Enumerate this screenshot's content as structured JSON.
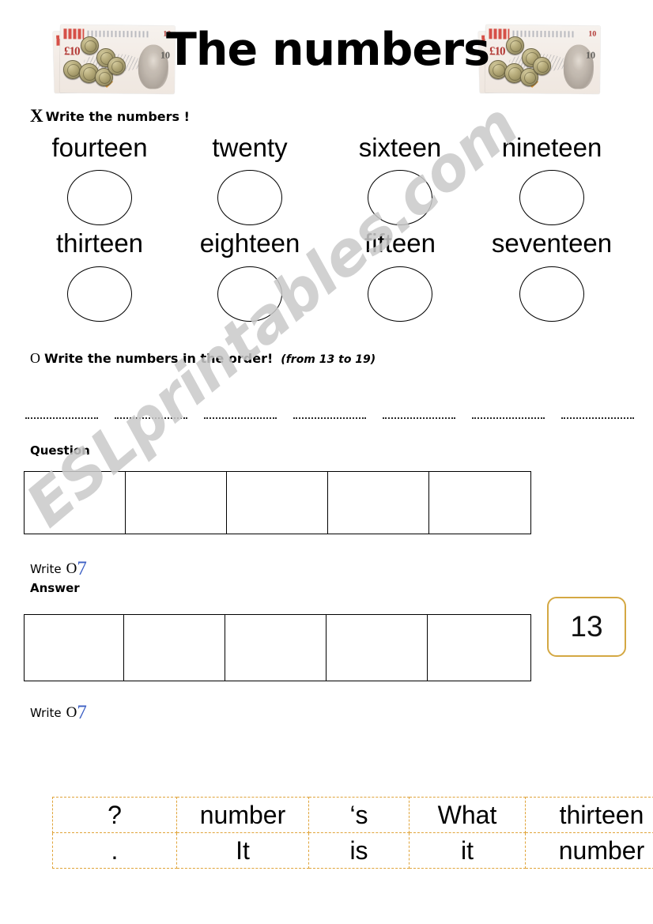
{
  "page": {
    "title": "The numbers",
    "watermark": "ESLprintables.com",
    "accent_orange": "#d4a843",
    "accent_blue": "#3c5fc4"
  },
  "decor": {
    "money_left": "banknote-coins-photo",
    "money_right": "banknote-coins-photo",
    "note_value": "£10"
  },
  "exercise1": {
    "bullet": "X",
    "instruction": "Write the numbers !",
    "row1": [
      "fourteen",
      "twenty",
      "sixteen",
      "nineteen"
    ],
    "row2": [
      "thirteen",
      "eighteen",
      "fifteen",
      "seventeen"
    ]
  },
  "exercise2": {
    "bullet": "O",
    "instruction": "Write the numbers in the order!",
    "hint": "(from 13 to 19)",
    "blank_count": 7
  },
  "question_section": {
    "label": "Question",
    "cell_count": 5,
    "write_prompt": {
      "word": "Write",
      "circle": "O",
      "symbol": "7"
    }
  },
  "answer_section": {
    "label": "Answer",
    "cell_count": 5,
    "badge": "13",
    "write_prompt": {
      "word": "Write",
      "circle": "O",
      "symbol": "7"
    }
  },
  "word_cards": {
    "rows": [
      [
        "?",
        "number",
        "‘s",
        "What",
        "thirteen"
      ],
      [
        ".",
        "It",
        "is",
        "it",
        "number"
      ]
    ]
  }
}
